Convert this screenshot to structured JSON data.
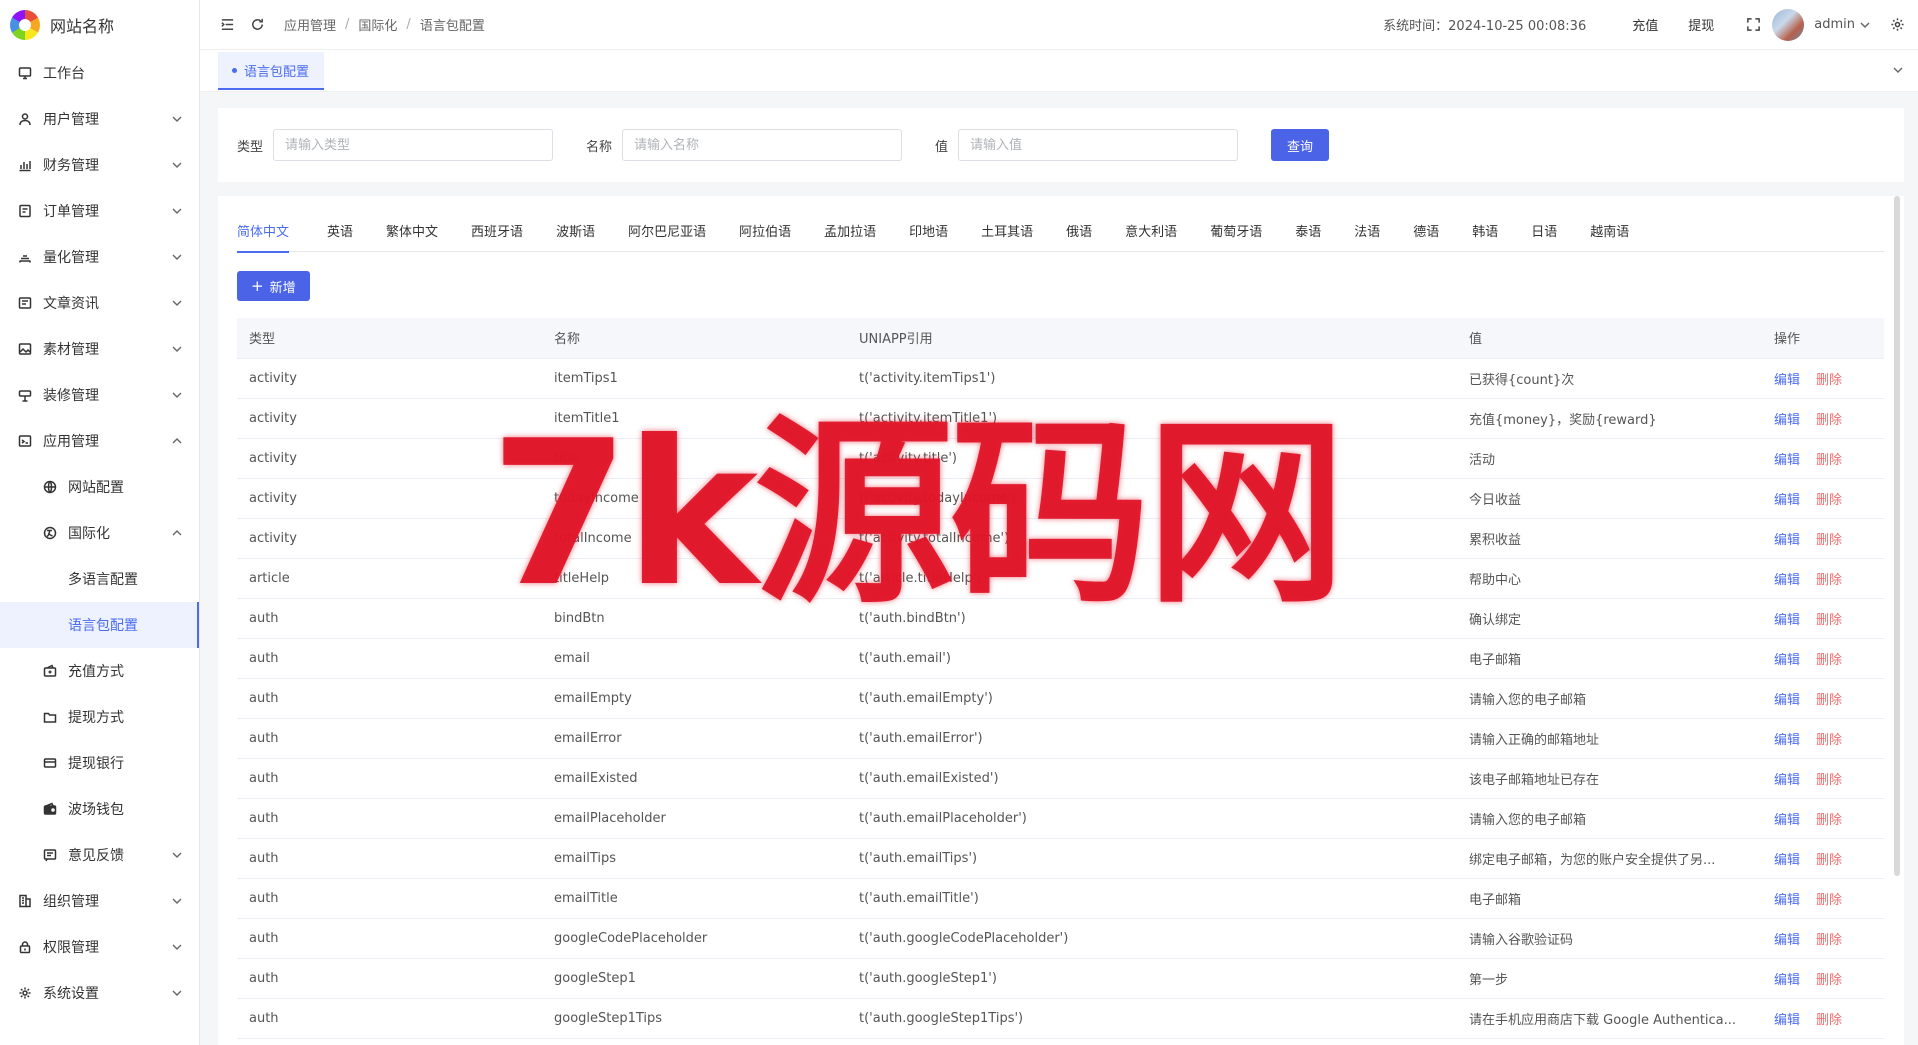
{
  "brand": {
    "name": "网站名称"
  },
  "sidebar": {
    "items": [
      {
        "label": "工作台",
        "icon": "monitor-icon",
        "level": 0,
        "chevron": ""
      },
      {
        "label": "用户管理",
        "icon": "user-icon",
        "level": 0,
        "chevron": "down"
      },
      {
        "label": "财务管理",
        "icon": "chart-icon",
        "level": 0,
        "chevron": "down"
      },
      {
        "label": "订单管理",
        "icon": "order-icon",
        "level": 0,
        "chevron": "down"
      },
      {
        "label": "量化管理",
        "icon": "quant-icon",
        "level": 0,
        "chevron": "down"
      },
      {
        "label": "文章资讯",
        "icon": "article-icon",
        "level": 0,
        "chevron": "down"
      },
      {
        "label": "素材管理",
        "icon": "image-icon",
        "level": 0,
        "chevron": "down"
      },
      {
        "label": "装修管理",
        "icon": "decor-icon",
        "level": 0,
        "chevron": "down"
      },
      {
        "label": "应用管理",
        "icon": "app-icon",
        "level": 0,
        "chevron": "up"
      },
      {
        "label": "网站配置",
        "icon": "globe-icon",
        "level": 1,
        "chevron": ""
      },
      {
        "label": "国际化",
        "icon": "i18n-icon",
        "level": 1,
        "chevron": "up"
      },
      {
        "label": "多语言配置",
        "icon": "",
        "level": 2,
        "chevron": ""
      },
      {
        "label": "语言包配置",
        "icon": "",
        "level": 2,
        "chevron": "",
        "active": true
      },
      {
        "label": "充值方式",
        "icon": "recharge-icon",
        "level": 1,
        "chevron": ""
      },
      {
        "label": "提现方式",
        "icon": "folder-icon",
        "level": 1,
        "chevron": ""
      },
      {
        "label": "提现银行",
        "icon": "card-icon",
        "level": 1,
        "chevron": ""
      },
      {
        "label": "波场钱包",
        "icon": "wallet-icon",
        "level": 1,
        "chevron": ""
      },
      {
        "label": "意见反馈",
        "icon": "feedback-icon",
        "level": 1,
        "chevron": "down"
      },
      {
        "label": "组织管理",
        "icon": "org-icon",
        "level": 0,
        "chevron": "down"
      },
      {
        "label": "权限管理",
        "icon": "lock-icon",
        "level": 0,
        "chevron": "down"
      },
      {
        "label": "系统设置",
        "icon": "gear-icon",
        "level": 0,
        "chevron": "down"
      }
    ]
  },
  "header": {
    "breadcrumb": [
      "应用管理",
      "国际化",
      "语言包配置"
    ],
    "system_time": "系统时间：2024-10-25 00:08:36",
    "recharge": "充值",
    "withdraw": "提现",
    "username": "admin"
  },
  "tagbar": {
    "active_tag": "语言包配置"
  },
  "filter": {
    "type_label": "类型",
    "type_placeholder": "请输入类型",
    "name_label": "名称",
    "name_placeholder": "请输入名称",
    "value_label": "值",
    "value_placeholder": "请输入值",
    "search_button": "查询"
  },
  "tabs": [
    "简体中文",
    "英语",
    "繁体中文",
    "西班牙语",
    "波斯语",
    "阿尔巴尼亚语",
    "阿拉伯语",
    "孟加拉语",
    "印地语",
    "土耳其语",
    "俄语",
    "意大利语",
    "葡萄牙语",
    "泰语",
    "法语",
    "德语",
    "韩语",
    "日语",
    "越南语"
  ],
  "add_button": "新增",
  "table": {
    "columns": [
      "类型",
      "名称",
      "UNIAPP引用",
      "值",
      "操作"
    ],
    "edit_label": "编辑",
    "delete_label": "删除",
    "rows": [
      [
        "activity",
        "itemTips1",
        "t('activity.itemTips1')",
        "已获得{count}次"
      ],
      [
        "activity",
        "itemTitle1",
        "t('activity.itemTitle1')",
        "充值{money}，奖励{reward}"
      ],
      [
        "activity",
        "title",
        "t('activity.title')",
        "活动"
      ],
      [
        "activity",
        "todayIncome",
        "t('activity.todayIncome')",
        "今日收益"
      ],
      [
        "activity",
        "totalIncome",
        "t('activity.totalIncome')",
        "累积收益"
      ],
      [
        "article",
        "titleHelp",
        "t('article.titleHelp')",
        "帮助中心"
      ],
      [
        "auth",
        "bindBtn",
        "t('auth.bindBtn')",
        "确认绑定"
      ],
      [
        "auth",
        "email",
        "t('auth.email')",
        "电子邮箱"
      ],
      [
        "auth",
        "emailEmpty",
        "t('auth.emailEmpty')",
        "请输入您的电子邮箱"
      ],
      [
        "auth",
        "emailError",
        "t('auth.emailError')",
        "请输入正确的邮箱地址"
      ],
      [
        "auth",
        "emailExisted",
        "t('auth.emailExisted')",
        "该电子邮箱地址已存在"
      ],
      [
        "auth",
        "emailPlaceholder",
        "t('auth.emailPlaceholder')",
        "请输入您的电子邮箱"
      ],
      [
        "auth",
        "emailTips",
        "t('auth.emailTips')",
        "绑定电子邮箱，为您的账户安全提供了另..."
      ],
      [
        "auth",
        "emailTitle",
        "t('auth.emailTitle')",
        "电子邮箱"
      ],
      [
        "auth",
        "googleCodePlaceholder",
        "t('auth.googleCodePlaceholder')",
        "请输入谷歌验证码"
      ],
      [
        "auth",
        "googleStep1",
        "t('auth.googleStep1')",
        "第一步"
      ],
      [
        "auth",
        "googleStep1Tips",
        "t('auth.googleStep1Tips')",
        "请在手机应用商店下载 Google Authentica..."
      ]
    ]
  },
  "watermark": {
    "text": "7k源码网"
  },
  "colors": {
    "primary": "#4b63e6",
    "accent": "#4b6cf0",
    "danger": "#f56c6c"
  }
}
